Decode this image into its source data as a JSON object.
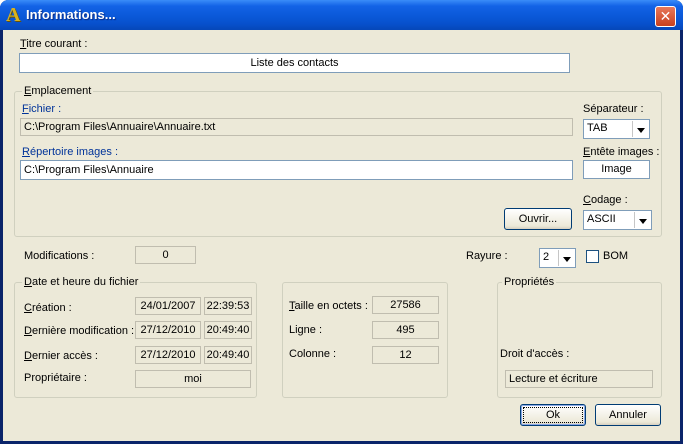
{
  "window": {
    "title": "Informations...",
    "app_icon": "A"
  },
  "titre": {
    "label": "Titre courant :",
    "value": "Liste des contacts"
  },
  "emplacement": {
    "label": "Emplacement",
    "fichier_label": "Fichier :",
    "fichier_value": "C:\\Program Files\\Annuaire\\Annuaire.txt",
    "repertoire_label": "Répertoire images :",
    "repertoire_value": "C:\\Program Files\\Annuaire",
    "separateur_label": "Séparateur :",
    "separateur_value": "TAB",
    "entete_label": "Entête images :",
    "entete_value": "Image",
    "codage_label": "Codage :",
    "codage_value": "ASCII",
    "ouvrir_label": "Ouvrir..."
  },
  "modifications": {
    "label": "Modifications :",
    "value": "0"
  },
  "rayure": {
    "label": "Rayure :",
    "value": "2"
  },
  "bom": {
    "label": "BOM",
    "checked": false
  },
  "date_group": {
    "label": "Date et heure du fichier",
    "creation_label": "Création :",
    "creation_date": "24/01/2007",
    "creation_time": "22:39:53",
    "modif_label": "Dernière modification :",
    "modif_date": "27/12/2010",
    "modif_time": "20:49:40",
    "acces_label": "Dernier accès :",
    "acces_date": "27/12/2010",
    "acces_time": "20:49:40",
    "proprietaire_label": "Propriétaire :",
    "proprietaire_value": "moi"
  },
  "size_group": {
    "taille_label": "Taille en octets :",
    "taille_value": "27586",
    "ligne_label": "Ligne :",
    "ligne_value": "495",
    "colonne_label": "Colonne :",
    "colonne_value": "12"
  },
  "props_group": {
    "label": "Propriétés",
    "droit_label": "Droit d'accès :",
    "droit_value": "Lecture et écriture"
  },
  "buttons": {
    "ok_label": "Ok",
    "annuler_label": "Annuler"
  },
  "colors": {
    "titlebar": "#0a58d8",
    "dialog_bg": "#ece9d8",
    "link": "#003399",
    "close": "#c8401e"
  }
}
